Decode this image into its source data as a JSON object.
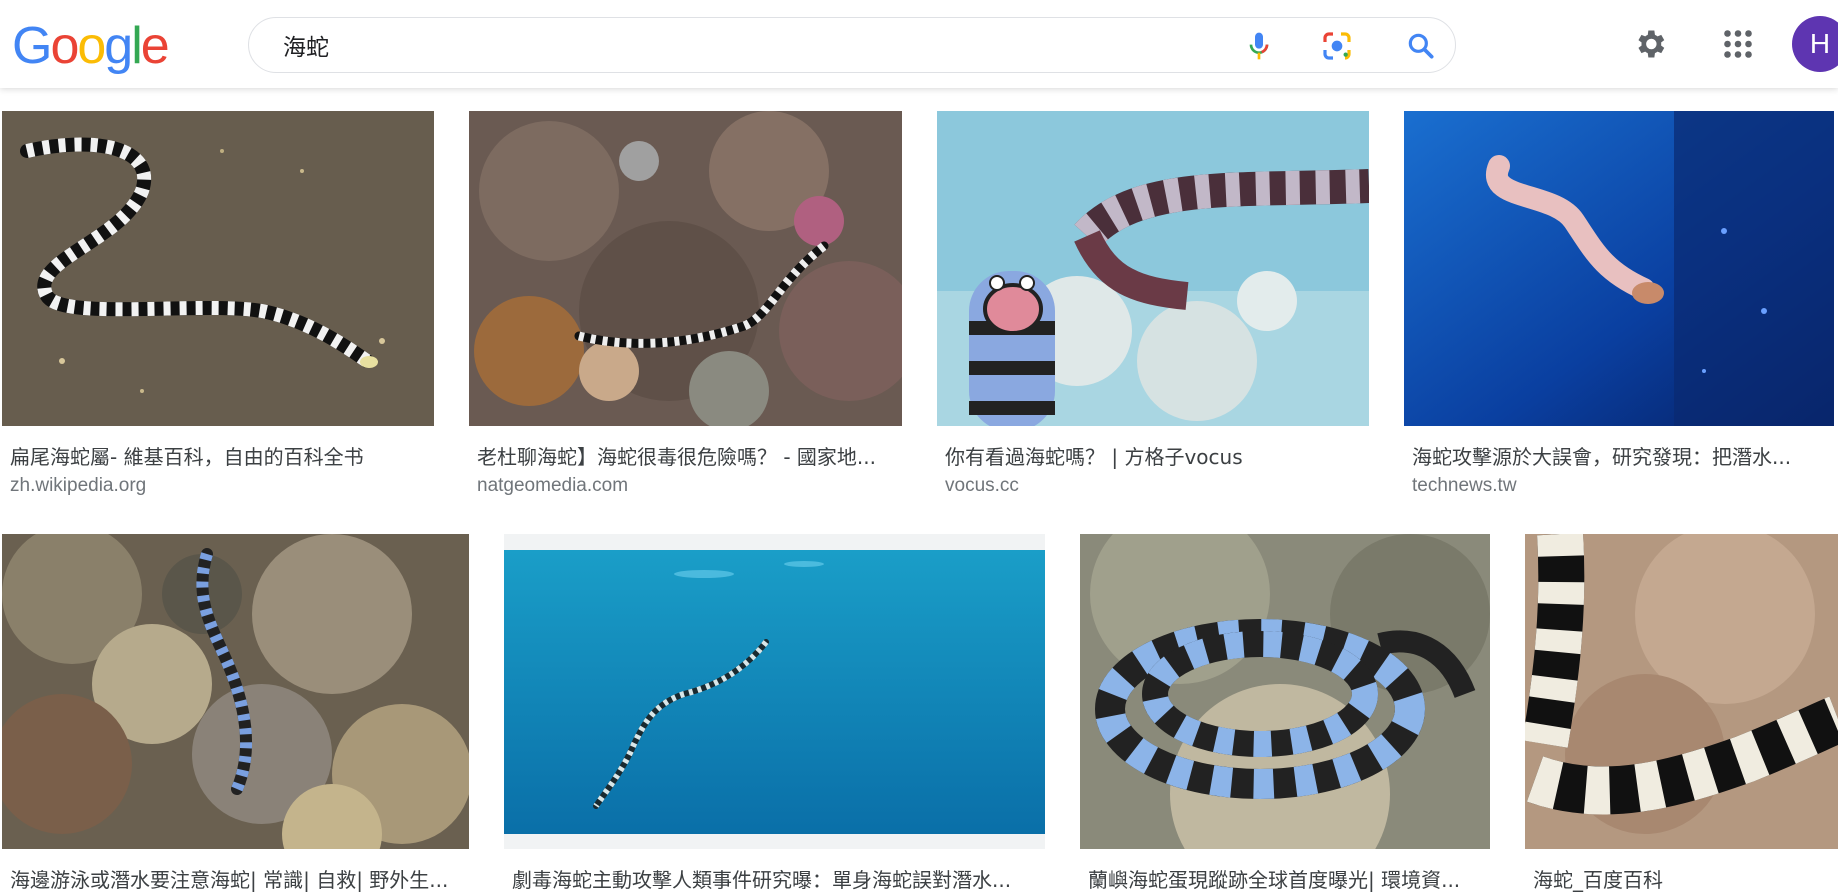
{
  "search": {
    "query": "海蛇"
  },
  "logo": {
    "letters": [
      "G",
      "o",
      "o",
      "g",
      "l",
      "e"
    ],
    "colors": [
      "#4285F4",
      "#EA4335",
      "#FBBC05",
      "#4285F4",
      "#34A853",
      "#EA4335"
    ]
  },
  "user": {
    "initial": "H",
    "color": "#5e35b1"
  },
  "icons": {
    "mic": "microphone-icon",
    "lens": "camera-lens-icon",
    "search": "search-icon",
    "settings": "gear-icon",
    "apps": "apps-grid-icon"
  },
  "results_row1": [
    {
      "title": "扁尾海蛇屬- 維基百科，自由的百科全书",
      "domain": "zh.wikipedia.org",
      "scene": "sand"
    },
    {
      "title": "老杜聊海蛇】海蛇很毒很危險嗎？ - 國家地...",
      "domain": "natgeomedia.com",
      "scene": "reef"
    },
    {
      "title": "你有看過海蛇嗎？ | 方格子vocus",
      "domain": "vocus.cc",
      "scene": "cartoon"
    },
    {
      "title": "海蛇攻擊源於大誤會，研究發現：把潛水...",
      "domain": "technews.tw",
      "scene": "deepblue"
    }
  ],
  "results_row2": [
    {
      "title": "海邊游泳或潛水要注意海蛇| 常識| 自救| 野外生...",
      "scene": "coral"
    },
    {
      "title": "劇毒海蛇主動攻擊人類事件研究曝：單身海蛇誤對潛水...",
      "scene": "openwater"
    },
    {
      "title": "蘭嶼海蛇蛋現蹤跡全球首度曝光| 環境資...",
      "scene": "coiled"
    },
    {
      "title": "海蛇_百度百科",
      "scene": "closeup"
    }
  ]
}
